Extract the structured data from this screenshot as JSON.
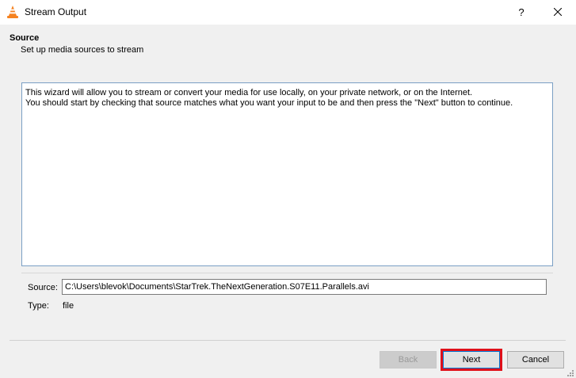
{
  "window": {
    "title": "Stream Output",
    "help_label": "?"
  },
  "header": {
    "title": "Source",
    "subtitle": "Set up media sources to stream"
  },
  "info": {
    "line1": "This wizard will allow you to stream or convert your media for use locally, on your private network, or on the Internet.",
    "line2": "You should start by checking that source matches what you want your input to be and then press the \"Next\" button to continue."
  },
  "source": {
    "label": "Source:",
    "value": "C:\\Users\\blevok\\Documents\\StarTrek.TheNextGeneration.S07E11.Parallels.avi"
  },
  "type": {
    "label": "Type:",
    "value": "file"
  },
  "buttons": {
    "back": "Back",
    "next": "Next",
    "cancel": "Cancel"
  },
  "colors": {
    "highlight": "#e0101a",
    "accent": "#0078d7"
  }
}
